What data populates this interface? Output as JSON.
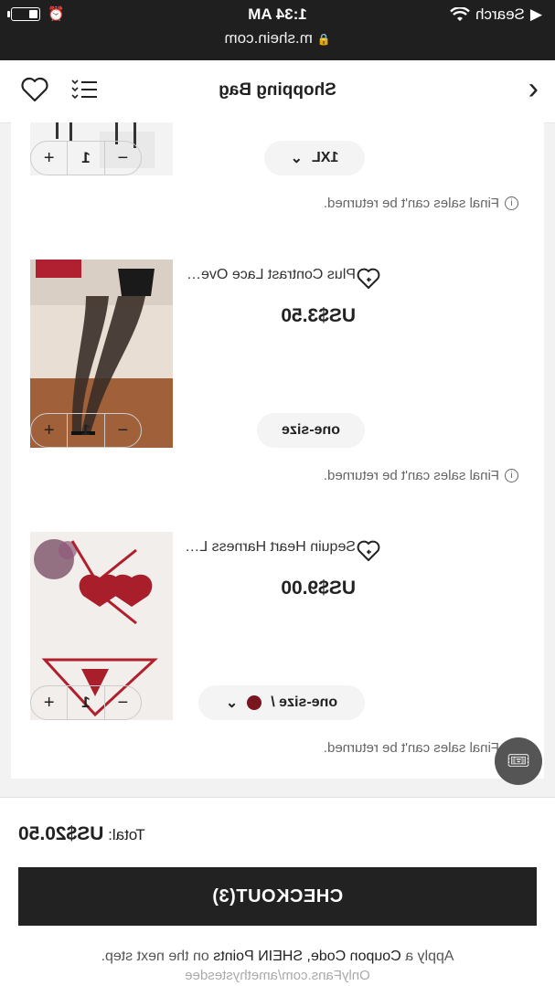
{
  "status_bar": {
    "back_label": "Search",
    "time": "1:34 AM",
    "url": "m.shein.com"
  },
  "nav": {
    "title": "Shopping Bag"
  },
  "items": [
    {
      "name": "",
      "price": "",
      "size": "1XL",
      "has_dropdown": true,
      "quantity": "1",
      "note": "Final sales can't be returned."
    },
    {
      "name": "Plus Contrast Lace Over The Kn...",
      "price": "US$3.50",
      "size": "one-size",
      "has_dropdown": false,
      "quantity": "1",
      "note": "Final sales can't be returned."
    },
    {
      "name": "Sequin Heart Harness Lingerie Set",
      "price": "US$9.00",
      "size": "one-size /",
      "has_dropdown": true,
      "swatch_color": "#7a1620",
      "quantity": "1",
      "note": "Final sales can't be returned."
    }
  ],
  "footer": {
    "total_label": "Total:",
    "total_value": "US$20.50",
    "checkout_label": "CHECKOUT(3)",
    "coupon_text_1": "Apply a",
    "coupon_text_2": "Coupon Code,",
    "coupon_text_3": "SHEIN Points",
    "coupon_text_4": "on the next step.",
    "watermark": "OnlyFans.com/amethystesdee"
  },
  "colors": {
    "status_bar_bg": "#1f1f1f",
    "checkout_bg": "#222222",
    "accent_red": "#b0202c"
  }
}
